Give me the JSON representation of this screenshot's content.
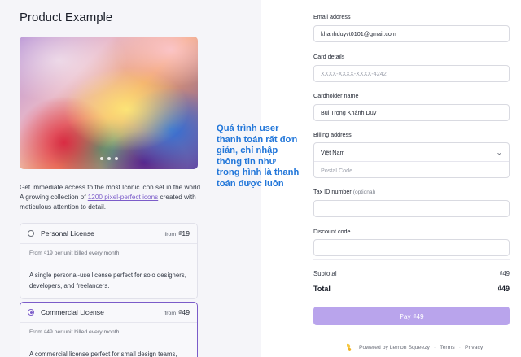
{
  "product": {
    "title": "Product Example",
    "description_prefix": "Get immediate access to the most Iconic icon set in the world. A growing collection of ",
    "description_link": "1200 pixel-perfect icons",
    "description_suffix": " created with meticulous attention to detail."
  },
  "annotation": "Quá trình user thanh toán rất đơn giản, chỉ nhập thông tin như trong hình là thanh toán được luôn",
  "plans": [
    {
      "name": "Personal License",
      "from_label": "from",
      "price": "₫19",
      "billing": "From ₫19 per unit billed every month",
      "description": "A single personal-use license perfect for solo designers, developers, and freelancers.",
      "selected": false
    },
    {
      "name": "Commercial License",
      "from_label": "from",
      "price": "₫49",
      "billing": "From ₫49 per unit billed every month",
      "description": "A commercial license perfect for small design teams,",
      "selected": true
    }
  ],
  "checkout": {
    "email_label": "Email address",
    "email_value": "khanhduyvt0101@gmail.com",
    "card_label": "Card details",
    "card_placeholder": "XXXX-XXXX-XXXX-4242",
    "cardholder_label": "Cardholder name",
    "cardholder_value": "Bùi Trọng Khánh Duy",
    "billing_label": "Billing address",
    "country_value": "Việt Nam",
    "postal_placeholder": "Postal Code",
    "tax_label": "Tax ID number",
    "tax_optional": "(optional)",
    "discount_label": "Discount code",
    "subtotal_label": "Subtotal",
    "subtotal_value": "₫49",
    "total_label": "Total",
    "total_value": "₫49",
    "pay_label": "Pay ₫49"
  },
  "footer": {
    "powered": "Powered by Lemon Squeezy",
    "terms": "Terms",
    "privacy": "Privacy",
    "separator": "·"
  },
  "colors": {
    "accent": "#7b5cc9",
    "pay_button": "#b9a4ec",
    "annotation": "#2176d9",
    "left_panel": "#f5f5f9"
  }
}
